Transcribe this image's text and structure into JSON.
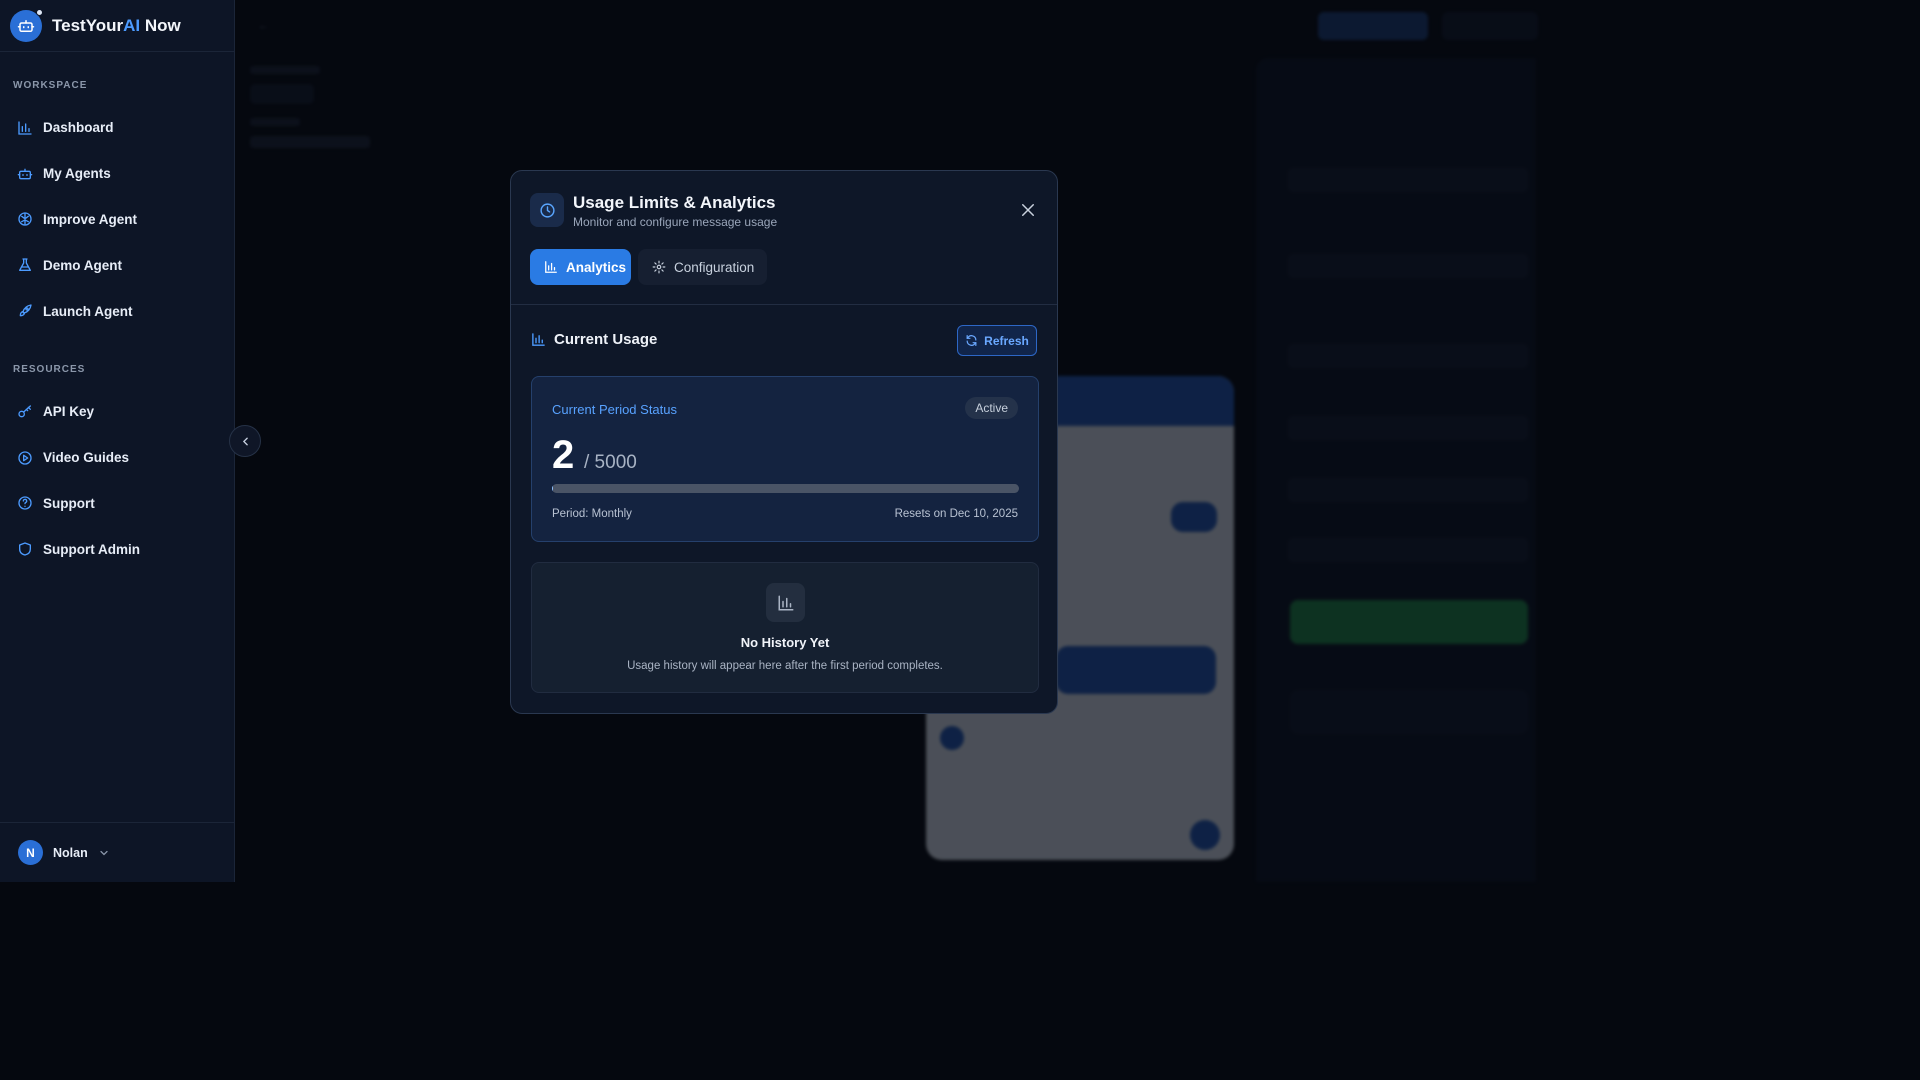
{
  "brand": {
    "name_prefix": "TestYour",
    "name_ai": "AI",
    "name_suffix": " Now"
  },
  "sidebar": {
    "workspace_label": "WORKSPACE",
    "workspace_items": [
      {
        "label": "Dashboard",
        "icon": "bar-chart-icon"
      },
      {
        "label": "My Agents",
        "icon": "robot-icon"
      },
      {
        "label": "Improve Agent",
        "icon": "brain-icon"
      },
      {
        "label": "Demo Agent",
        "icon": "flask-icon"
      },
      {
        "label": "Launch Agent",
        "icon": "rocket-icon"
      }
    ],
    "resources_label": "RESOURCES",
    "resources_items": [
      {
        "label": "API Key",
        "icon": "key-icon"
      },
      {
        "label": "Video Guides",
        "icon": "play-circle-icon"
      },
      {
        "label": "Support",
        "icon": "help-circle-icon"
      },
      {
        "label": "Support Admin",
        "icon": "shield-icon"
      }
    ]
  },
  "user": {
    "initial": "N",
    "name": "Nolan"
  },
  "modal": {
    "title": "Usage Limits & Analytics",
    "subtitle": "Monitor and configure message usage",
    "tabs": {
      "analytics": "Analytics",
      "configuration": "Configuration"
    },
    "current_usage": {
      "heading": "Current Usage",
      "refresh_label": "Refresh",
      "status_title": "Current Period Status",
      "status_badge": "Active",
      "used": "2",
      "limit_text": "/ 5000",
      "progress_fraction": 0.0004,
      "period_text": "Period: Monthly",
      "reset_text": "Resets on Dec 10, 2025"
    },
    "history": {
      "title": "No History Yet",
      "text": "Usage history will appear here after the first period completes."
    }
  },
  "colors": {
    "accent": "#2a7be4",
    "link": "#58a2ff",
    "sidebar_bg": "#0d1526",
    "modal_bg": "#0e1728"
  }
}
